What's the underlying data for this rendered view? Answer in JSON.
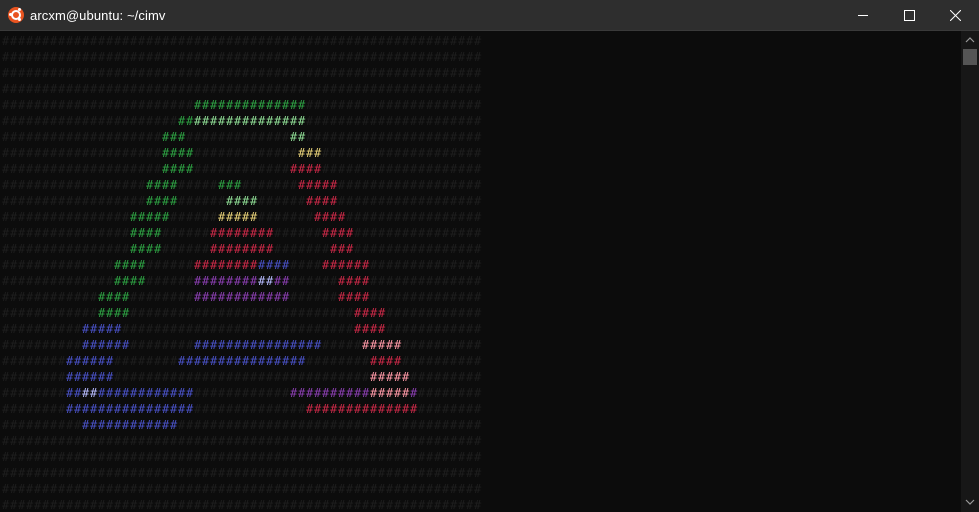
{
  "window": {
    "title": "arcxm@ubuntu: ~/cimv",
    "icon": "ubuntu-logo-icon",
    "controls": [
      "minimize-icon",
      "maximize-icon",
      "close-icon"
    ]
  },
  "terminal": {
    "fill_char": "#",
    "background": "#0c0c0c",
    "dim_color": "#1e1e1e",
    "colors": {
      "green": "#2ea043",
      "green_light": "#8fdc95",
      "red": "#c92a48",
      "red_light": "#ff9aa8",
      "blue": "#4a52c6",
      "blue_light": "#b8bcff",
      "purple": "#8a3fb0",
      "yellow": "#e8d27a"
    }
  }
}
